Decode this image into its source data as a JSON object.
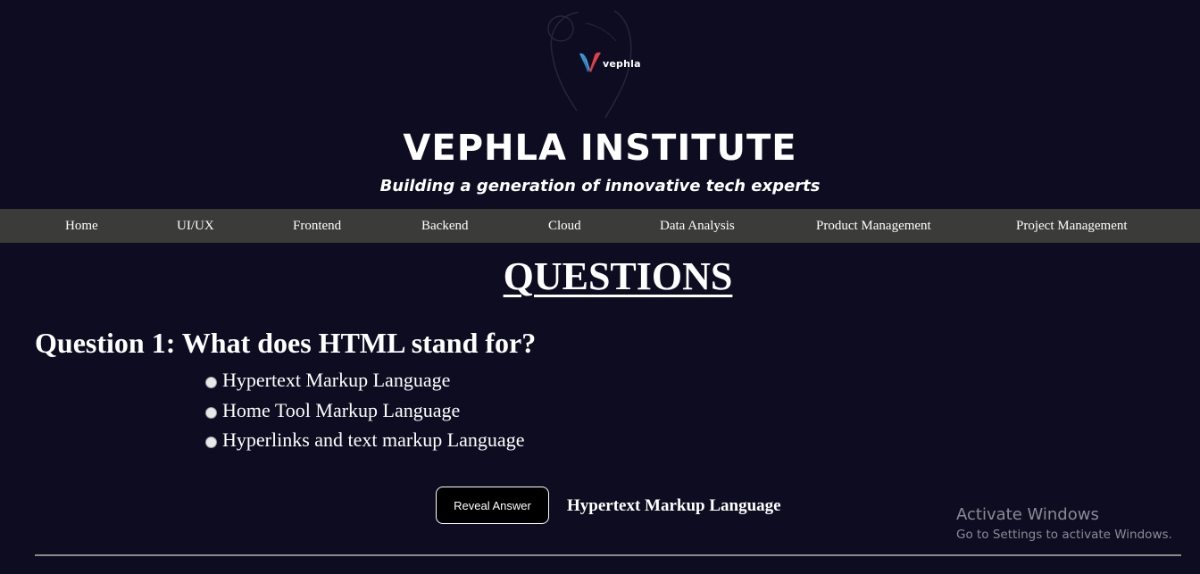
{
  "brand": {
    "logo_text": "vephla",
    "title": "VEPHLA INSTITUTE",
    "tagline": "Building a generation of innovative tech experts"
  },
  "nav": {
    "items": [
      {
        "label": "Home"
      },
      {
        "label": "UI/UX"
      },
      {
        "label": "Frontend"
      },
      {
        "label": "Backend"
      },
      {
        "label": "Cloud"
      },
      {
        "label": "Data Analysis"
      },
      {
        "label": "Product Management"
      },
      {
        "label": "Project Management"
      }
    ]
  },
  "questions": {
    "heading": "QUESTIONS",
    "q1": {
      "text": "Question 1: What does HTML stand for?",
      "options": [
        {
          "label": "Hypertext Markup Language"
        },
        {
          "label": "Home Tool Markup Language"
        },
        {
          "label": "Hyperlinks and text markup Language"
        }
      ],
      "reveal_button": "Reveal Answer",
      "answer": "Hypertext Markup Language"
    }
  },
  "watermark": {
    "title": "Activate Windows",
    "subtitle": "Go to Settings to activate Windows."
  },
  "colors": {
    "background": "#0d0c20",
    "nav_background": "#3b3b39",
    "text": "#ffffff"
  }
}
